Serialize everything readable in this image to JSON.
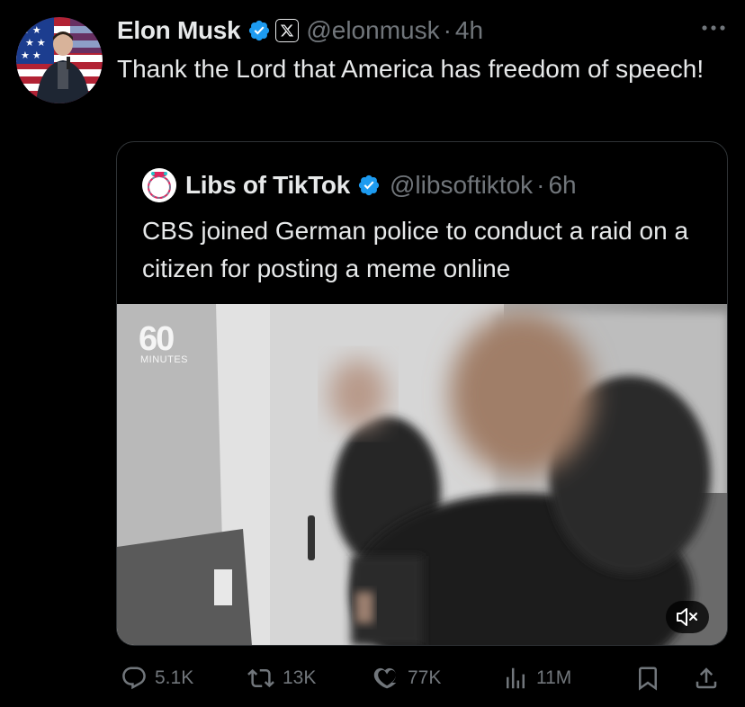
{
  "post": {
    "author_name": "Elon Musk",
    "handle": "@elonmusk",
    "time_sep": "·",
    "time": "4h",
    "text": "Thank the Lord that America has freedom of speech!"
  },
  "quote": {
    "author_name": "Libs of TikTok",
    "handle": "@libsoftiktok",
    "time_sep": "·",
    "time": "6h",
    "text": "CBS joined German police to conduct a raid on a citizen for posting a meme online",
    "avatar_text": "Libs of TikTok",
    "video": {
      "watermark_number": "60",
      "watermark_word": "MINUTES"
    }
  },
  "actions": {
    "replies": "5.1K",
    "reposts": "13K",
    "likes": "77K",
    "views": "11M"
  },
  "icons": {
    "verified": "verified-badge-icon",
    "affiliate": "x-logo-badge-icon",
    "more": "more-icon",
    "reply": "reply-icon",
    "repost": "repost-icon",
    "like": "heart-icon",
    "views": "views-icon",
    "bookmark": "bookmark-icon",
    "share": "share-icon",
    "mute": "volume-muted-icon"
  },
  "colors": {
    "background": "#000000",
    "text": "#e7e9ea",
    "secondary": "#71767b",
    "verified": "#1d9bf0",
    "border": "#2f3336"
  }
}
